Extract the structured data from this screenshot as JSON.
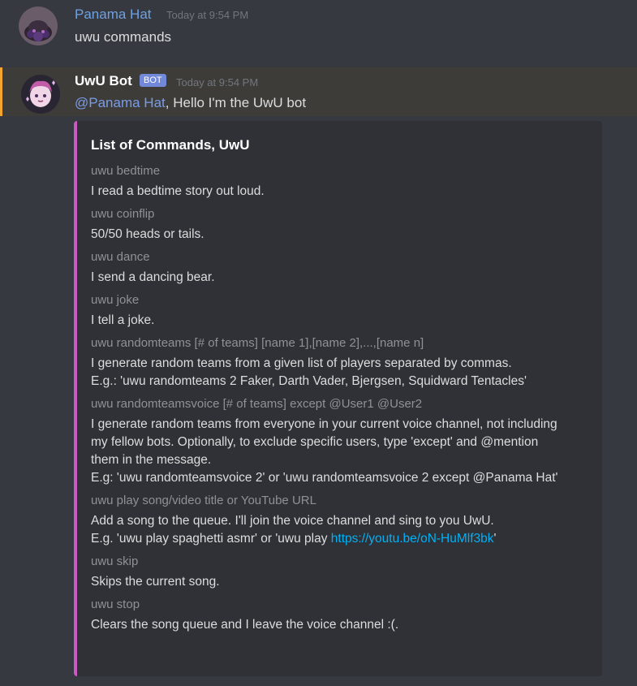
{
  "messages": [
    {
      "username": "Panama Hat",
      "timestamp": "Today at 9:54 PM",
      "content": "uwu commands"
    },
    {
      "username": "UwU Bot",
      "bot_tag": "BOT",
      "timestamp": "Today at 9:54 PM",
      "mention": "@Panama Hat",
      "content_after_mention": ", Hello I'm the UwU bot"
    }
  ],
  "embed": {
    "accent_color": "#c95bc0",
    "title": "List of Commands, UwU",
    "fields": [
      {
        "name": "uwu bedtime",
        "value_lines": [
          "I read a bedtime story out loud."
        ]
      },
      {
        "name": "uwu coinflip",
        "value_lines": [
          "50/50 heads or tails."
        ]
      },
      {
        "name": "uwu dance",
        "value_lines": [
          "I send a dancing bear."
        ]
      },
      {
        "name": "uwu joke",
        "value_lines": [
          "I tell a joke."
        ]
      },
      {
        "name": "uwu randomteams [# of teams] [name 1],[name 2],...,[name n]",
        "value_lines": [
          "I generate random teams from a given list of players separated by commas.",
          "E.g.: 'uwu randomteams 2 Faker, Darth Vader, Bjergsen, Squidward Tentacles'"
        ]
      },
      {
        "name": "uwu randomteamsvoice [# of teams] except @User1 @User2",
        "value_lines": [
          "I generate random teams from everyone in your current voice channel, not including",
          "my fellow bots. Optionally, to exclude specific users, type 'except' and @mention",
          "them in the message.",
          "E.g: 'uwu randomteamsvoice 2' or 'uwu randomteamsvoice 2 except @Panama Hat'"
        ]
      },
      {
        "name": "uwu play song/video title or YouTube URL",
        "value_lines": [
          "Add a song to the queue. I'll join the voice channel and sing to you UwU."
        ],
        "link_line": {
          "before": "E.g. 'uwu play spaghetti asmr' or 'uwu play ",
          "link": "https://youtu.be/oN-HuMlf3bk",
          "after": "'"
        }
      },
      {
        "name": "uwu skip",
        "value_lines": [
          "Skips the current song."
        ]
      },
      {
        "name": "uwu stop",
        "value_lines": [
          "Clears the song queue and I leave the voice channel :(."
        ]
      }
    ]
  }
}
